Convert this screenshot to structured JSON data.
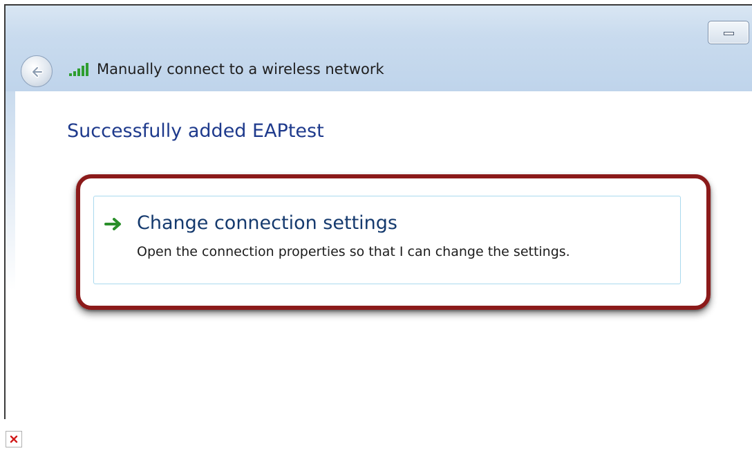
{
  "window": {
    "title": "Manually connect to a wireless network"
  },
  "content": {
    "heading": "Successfully added EAPtest",
    "command_link": {
      "title": "Change connection settings",
      "description": "Open the connection properties so that I can change the settings."
    }
  },
  "icons": {
    "back": "back-arrow-icon",
    "signal": "wireless-signal-icon",
    "command": "green-arrow-icon",
    "broken_image": "broken-image-icon"
  },
  "colors": {
    "heading": "#1e3a8c",
    "command_title": "#153a6e",
    "highlight_border": "#8b1a1a",
    "command_border": "#a9d9ee"
  }
}
